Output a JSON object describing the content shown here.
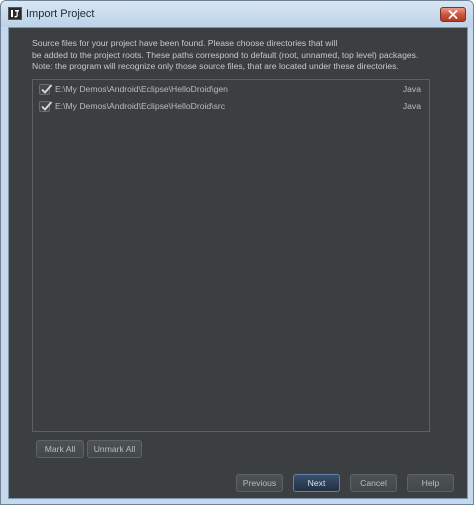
{
  "window": {
    "title": "Import Project"
  },
  "description": {
    "line1": "Source files for your project have been found. Please choose directories that will",
    "line2": "be added to the project roots. These paths correspond to default (root, unnamed, top level) packages.",
    "line3": "Note: the program will recognize only those source files, that are located under these directories."
  },
  "roots": [
    {
      "checked": true,
      "path": "E:\\My Demos\\Android\\Eclipse\\HelloDroid\\gen",
      "type": "Java"
    },
    {
      "checked": true,
      "path": "E:\\My Demos\\Android\\Eclipse\\HelloDroid\\src",
      "type": "Java"
    }
  ],
  "buttons": {
    "mark_all": "Mark All",
    "unmark_all": "Unmark All",
    "previous": "Previous",
    "next": "Next",
    "cancel": "Cancel",
    "help": "Help"
  },
  "icons": {
    "app": "intellij-app-icon",
    "close": "close-icon",
    "check": "checkmark-icon"
  },
  "colors": {
    "dialog_bg": "#3c3f41",
    "titlebar": "#c6d9ec",
    "close_button": "#c9503a",
    "default_button": "#233143"
  }
}
